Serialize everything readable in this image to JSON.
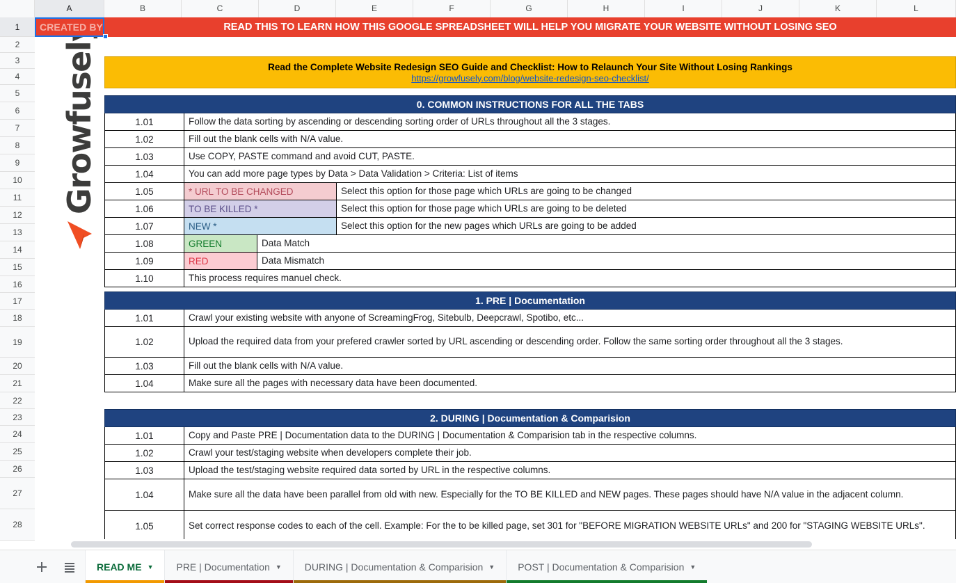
{
  "grid": {
    "columns": [
      "A",
      "B",
      "C",
      "D",
      "E",
      "F",
      "G",
      "H",
      "I",
      "J",
      "K",
      "L"
    ],
    "selected_column": "A",
    "rows": [
      "1",
      "2",
      "3",
      "4",
      "5",
      "6",
      "7",
      "8",
      "9",
      "10",
      "11",
      "12",
      "13",
      "14",
      "15",
      "16",
      "17",
      "18",
      "19",
      "20",
      "21",
      "22",
      "23",
      "24",
      "25",
      "26",
      "27",
      "28"
    ],
    "selected_row": "1"
  },
  "header": {
    "created_by_label": "CREATED BY",
    "read_this_banner": "READ THIS TO LEARN HOW THIS GOOGLE SPREADSHEET WILL HELP YOU MIGRATE YOUR WEBSITE WITHOUT LOSING SEO",
    "logo_text": "Growfusely"
  },
  "guide": {
    "title": "Read the Complete Website Redesign SEO Guide and Checklist: How to Relaunch Your Site Without Losing Rankings",
    "link": "https://growfusely.com/blog/website-redesign-seo-checklist/"
  },
  "sections": [
    {
      "title": "0. COMMON INSTRUCTIONS FOR ALL THE TABS",
      "rows": [
        {
          "num": "1.01",
          "text": "Follow the data sorting by ascending or descending sorting order of URLs throughout all the 3 stages."
        },
        {
          "num": "1.02",
          "text": "Fill out the blank cells with N/A value."
        },
        {
          "num": "1.03",
          "text": "Use COPY, PASTE command and avoid CUT, PASTE."
        },
        {
          "num": "1.04",
          "text": "You can add more page types by Data > Data Validation > Criteria: List of items"
        },
        {
          "num": "1.05",
          "swatch": "* URL TO BE CHANGED",
          "swatch_style": "sw-pink",
          "text": "Select this option for those page which URLs are going to be changed"
        },
        {
          "num": "1.06",
          "swatch": "TO BE KILLED *",
          "swatch_style": "sw-purple",
          "text": "Select this option for those page which URLs are going to be deleted"
        },
        {
          "num": "1.07",
          "swatch": "NEW *",
          "swatch_style": "sw-blue",
          "text": "Select this option for the new pages which URLs are going to be added"
        },
        {
          "num": "1.08",
          "swatch": "GREEN",
          "swatch_style": "sw-green",
          "swatch_narrow": true,
          "text": "Data Match"
        },
        {
          "num": "1.09",
          "swatch": "RED",
          "swatch_style": "sw-red",
          "swatch_narrow": true,
          "text": "Data Mismatch"
        },
        {
          "num": "1.10",
          "text": "This process requires manuel check."
        }
      ]
    },
    {
      "title": "1. PRE | Documentation",
      "rows": [
        {
          "num": "1.01",
          "text": "Crawl your existing website with anyone of ScreamingFrog, Sitebulb, Deepcrawl, Spotibo, etc..."
        },
        {
          "num": "1.02",
          "text": "Upload the required data from your prefered crawler sorted by URL ascending or descending order. Follow the same sorting order throughout all the 3 stages.",
          "tall": true
        },
        {
          "num": "1.03",
          "text": "Fill out the blank cells with N/A value."
        },
        {
          "num": "1.04",
          "text": "Make sure all the pages with necessary data have been documented."
        }
      ]
    },
    {
      "title": "2. DURING | Documentation & Comparision",
      "rows": [
        {
          "num": "1.01",
          "text": "Copy and Paste PRE | Documentation data to the DURING | Documentation & Comparision tab in the respective columns."
        },
        {
          "num": "1.02",
          "text": "Crawl your test/staging website when developers complete their job."
        },
        {
          "num": "1.03",
          "text": "Upload the test/staging website required data sorted by URL in the respective columns."
        },
        {
          "num": "1.04",
          "text": "Make sure all the data have been parallel from old with new. Especially for the TO BE KILLED and NEW pages. These pages should have N/A value in the adjacent column.",
          "tall": true
        },
        {
          "num": "1.05",
          "text": "Set correct response codes to each of the cell. Example: For the to be killed page, set 301 for \"BEFORE MIGRATION WEBSITE URLs\" and 200 for \"STAGING WEBSITE URLs\".",
          "tall": true
        }
      ]
    }
  ],
  "tabbar": {
    "add_sheet_icon": "plus-icon",
    "all_sheets_icon": "hamburger-icon",
    "tabs": [
      {
        "label": "READ ME",
        "accent": "#f29900",
        "active": true
      },
      {
        "label": "PRE | Documentation",
        "accent": "#a30d18",
        "active": false
      },
      {
        "label": "DURING | Documentation & Comparision",
        "accent": "#9c6a0a",
        "active": false
      },
      {
        "label": "POST | Documentation & Comparision",
        "accent": "#127b2c",
        "active": false
      }
    ]
  },
  "colors": {
    "banner_red": "#e8402d",
    "banner_orange": "#fbbc04",
    "section_blue": "#1f4380",
    "link_blue": "#1155cc"
  }
}
